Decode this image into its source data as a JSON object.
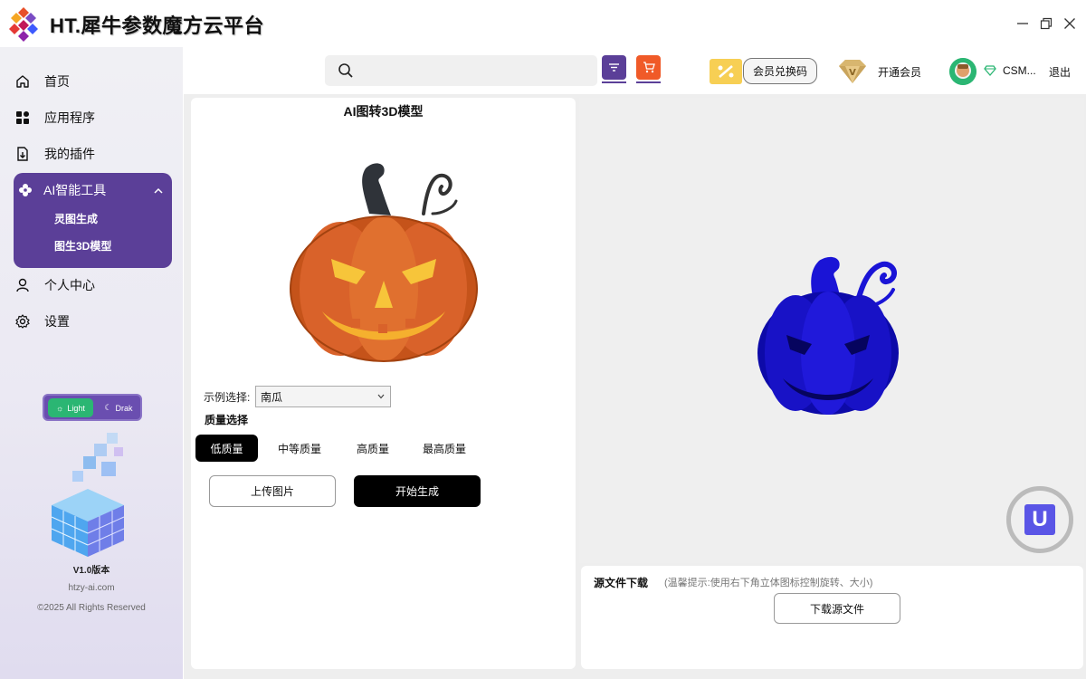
{
  "app": {
    "title": "HT.犀牛参数魔方云平台"
  },
  "window_controls": {
    "minimize_icon": "minimize-icon",
    "restore_icon": "restore-icon",
    "close_icon": "close-icon"
  },
  "sidebar": {
    "items": [
      {
        "label": "首页",
        "icon": "home-icon"
      },
      {
        "label": "应用程序",
        "icon": "apps-icon"
      },
      {
        "label": "我的插件",
        "icon": "plugin-icon"
      },
      {
        "label": "AI智能工具",
        "icon": "flower-icon",
        "expanded": true,
        "children": [
          {
            "label": "灵图生成"
          },
          {
            "label": "图生3D模型"
          }
        ]
      },
      {
        "label": "个人中心",
        "icon": "user-icon"
      },
      {
        "label": "设置",
        "icon": "gear-icon"
      }
    ],
    "theme": {
      "light_label": "Light",
      "dark_label": "Drak",
      "selected": "Light"
    },
    "version": "V1.0版本",
    "site": "htzy-ai.com",
    "copyright": "©2025 All Rights Reserved"
  },
  "topbar": {
    "search": {
      "value": "",
      "placeholder": ""
    },
    "redeem_label": "会员兑换码",
    "vip_label": "开通会员",
    "user_name": "CSM...",
    "logout_label": "退出"
  },
  "left_panel": {
    "title": "AI图转3D模型",
    "example_label": "示例选择:",
    "example_selected": "南瓜",
    "quality_label": "质量选择",
    "quality_options": [
      "低质量",
      "中等质量",
      "高质量",
      "最高质量"
    ],
    "quality_selected": "低质量",
    "upload_label": "上传图片",
    "generate_label": "开始生成"
  },
  "download": {
    "title": "源文件下载",
    "hint": "(温馨提示:使用右下角立体图标控制旋转、大小)",
    "button_label": "下载源文件"
  },
  "colors": {
    "accent_purple": "#5b3f98",
    "accent_orange": "#f05a28",
    "theme_green": "#2bb673",
    "model_blue": "#1a14d6",
    "badge_blue": "#5a55e6"
  }
}
